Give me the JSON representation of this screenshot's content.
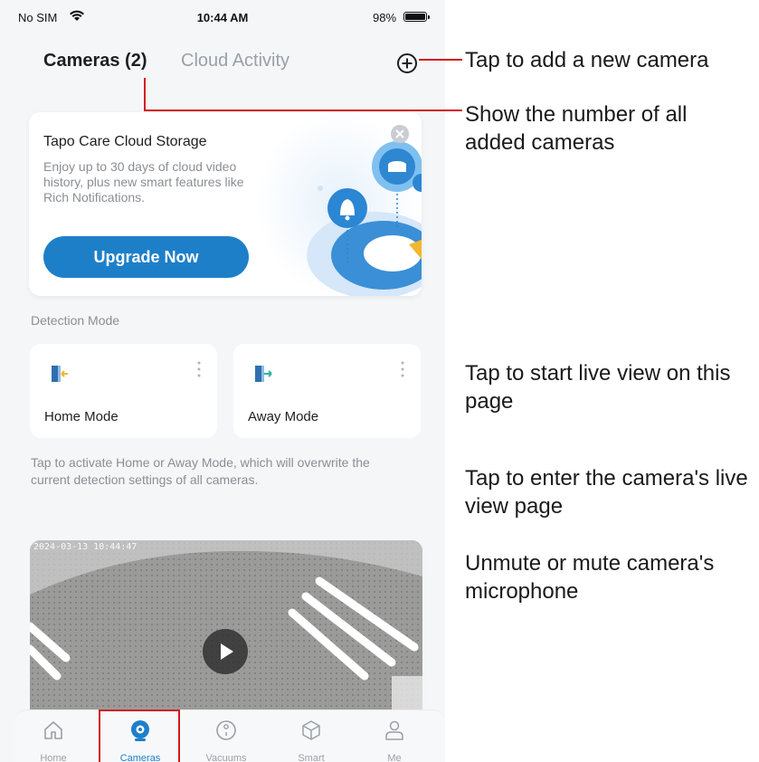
{
  "status_bar": {
    "carrier": "No SIM",
    "time": "10:44 AM",
    "battery_pct": "98%"
  },
  "header": {
    "tab_cameras": "Cameras (2)",
    "tab_cloud": "Cloud Activity",
    "add_icon": "plus-circle-icon"
  },
  "promo": {
    "title": "Tapo Care Cloud Storage",
    "text": "Enjoy up to 30 days of cloud video history, plus new smart features like Rich Notifications.",
    "button": "Upgrade Now",
    "close_icon": "close-icon"
  },
  "detection": {
    "label": "Detection Mode",
    "modes": [
      {
        "label": "Home Mode",
        "icon": "home-mode-icon"
      },
      {
        "label": "Away Mode",
        "icon": "away-mode-icon"
      }
    ],
    "hint": "Tap to activate Home or Away Mode, which will overwrite the current detection settings of all cameras."
  },
  "camera": {
    "timestamp": "2024-03-13 10:44:47",
    "play_icon": "play-icon"
  },
  "nav": {
    "items": [
      {
        "label": "Home",
        "icon": "home-icon"
      },
      {
        "label": "Cameras",
        "icon": "camera-icon"
      },
      {
        "label": "Vacuums",
        "icon": "vacuum-icon"
      },
      {
        "label": "Smart",
        "icon": "cube-icon"
      },
      {
        "label": "Me",
        "icon": "person-icon"
      }
    ]
  },
  "callouts": {
    "add_camera": "Tap to add a new camera",
    "count": "Show the number of all added cameras",
    "live_view": "Tap to start live view on this page",
    "enter_live": "Tap to enter the camera's live view page",
    "mute": "Unmute or mute camera's microphone"
  },
  "colors": {
    "accent": "#1e7fc9",
    "callout_line": "#d11a1a",
    "background": "#f5f6f8"
  }
}
